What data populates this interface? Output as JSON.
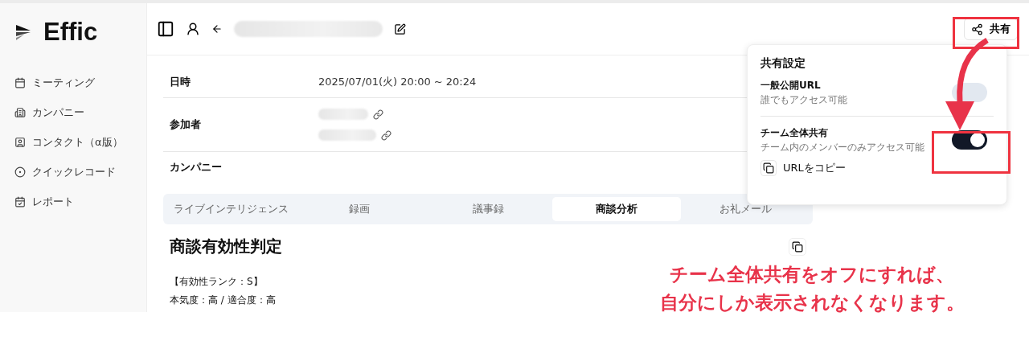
{
  "sidebar": {
    "logo": "Effic",
    "items": [
      {
        "kind": "calendar",
        "label": "ミーティング",
        "selected": false
      },
      {
        "kind": "building",
        "label": "カンパニー",
        "selected": false
      },
      {
        "kind": "contact",
        "label": "コンタクト（α版）",
        "selected": false
      },
      {
        "kind": "record",
        "label": "クイックレコード",
        "selected": false
      },
      {
        "kind": "report",
        "label": "レポート",
        "selected": false
      }
    ]
  },
  "header": {
    "share_button": "共有"
  },
  "details": [
    {
      "kind": "text",
      "label": "日時",
      "value": "2025/07/01(火) 20:00 ~ 20:24"
    },
    {
      "kind": "people",
      "label": "参加者",
      "participants": [
        {
          "kind": "blurred"
        },
        {
          "kind": "blurred"
        }
      ]
    },
    {
      "kind": "text",
      "label": "カンパニー"
    }
  ],
  "tabs": [
    {
      "label": "ライブインテリジェンス",
      "selected": false
    },
    {
      "label": "録画",
      "selected": false
    },
    {
      "label": "議事録",
      "selected": false
    },
    {
      "label": "商談分析",
      "selected": true
    },
    {
      "label": "お礼メール",
      "selected": false
    }
  ],
  "analysis": {
    "title": "商談有効性判定",
    "lines": [
      "【有効性ランク：S】",
      "本気度：高 / 適合度：高"
    ]
  },
  "share_popover": {
    "title": "共有設定",
    "options": [
      {
        "label": "一般公開URL",
        "description": "誰でもアクセス可能",
        "on": false
      },
      {
        "label": "チーム全体共有",
        "description": "チーム内のメンバーのみアクセス可能",
        "on": true
      }
    ],
    "copy_button": "URLをコピー"
  },
  "annotation": {
    "lines": [
      "チーム全体共有をオフにすれば、",
      "自分にしか表示されなくなります。"
    ]
  }
}
